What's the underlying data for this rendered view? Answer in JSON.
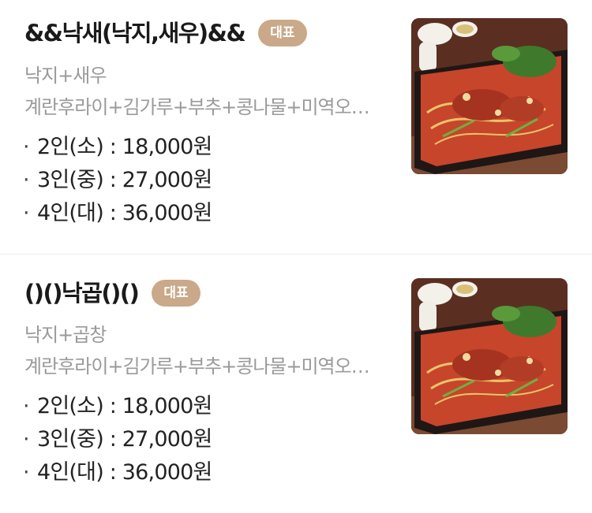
{
  "menu_items": [
    {
      "name": "&&낙새(낙지,새우)&&",
      "badge": "대표",
      "subtitle": "낙지+새우",
      "description": "계란후라이+김가루+부추+콩나물+미역오…",
      "prices": [
        "2인(소) : 18,000원",
        "3인(중) : 27,000원",
        "4인(대) : 36,000원"
      ],
      "image": "nakji-seafood-platter-photo"
    },
    {
      "name": "()()낙곱()()",
      "badge": "대표",
      "subtitle": "낙지+곱창",
      "description": "계란후라이+김가루+부추+콩나물+미역오…",
      "prices": [
        "2인(소) : 18,000원",
        "3인(중) : 27,000원",
        "4인(대) : 36,000원"
      ],
      "image": "nakji-gopchang-platter-photo"
    }
  ],
  "bullet": "·",
  "colors": {
    "badge": "#c9a989",
    "subtle_text": "#9a9a9a",
    "divider": "#ececec"
  }
}
